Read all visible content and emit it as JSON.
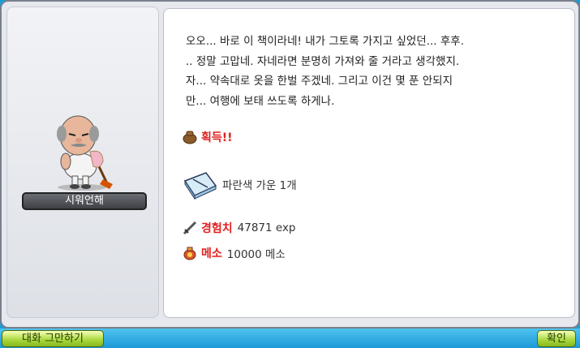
{
  "npc": {
    "name": "시워언해"
  },
  "dialog": {
    "message": "오오... 바로 이 책이라네! 내가 그토록 가지고 싶었던... 후후.\n.. 정말 고맙네. 자네라면 분명히 가져와 줄 거라고 생각했지.\n자... 약속대로 옷을 한벌 주겠네. 그리고 이건 몇 푼 안되지\n만... 여행에 보태 쓰도록 하게나."
  },
  "reward": {
    "header": "획득!!",
    "item": "파란색 가운 1개",
    "exp_label": "경험치",
    "exp_value": "47871 exp",
    "meso_label": "메소",
    "meso_value": "10000 메소"
  },
  "buttons": {
    "end_chat": "대화 그만하기",
    "confirm": "확인"
  },
  "icons": {
    "reward_bag": "reward-bag-icon",
    "item": "blue-gown-icon",
    "exp": "sword-icon",
    "meso": "meso-bag-icon"
  }
}
